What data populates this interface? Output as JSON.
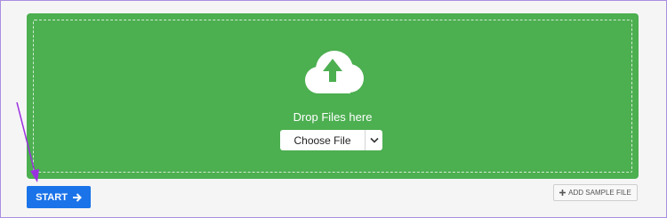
{
  "dropzone": {
    "icon": "cloud-upload-icon",
    "label": "Drop Files here",
    "choose_label": "Choose File",
    "dropdown_icon": "chevron-down-icon",
    "color": "#4caf50"
  },
  "actions": {
    "start_label": "START",
    "start_icon": "arrow-right-icon",
    "start_color": "#1a73e8",
    "sample_label": "ADD SAMPLE FILE",
    "sample_icon": "plus-icon"
  },
  "annotation": {
    "pointer": "arrow-annotation",
    "color": "#9b30e0"
  }
}
